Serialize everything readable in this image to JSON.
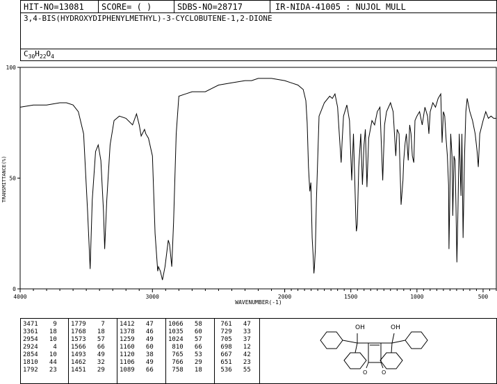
{
  "header": {
    "hit_no": "HIT-NO=13081",
    "score": "SCORE=  (   )",
    "sdbs_no": "SDBS-NO=28717",
    "ir_code": "IR-NIDA-41005 : NUJOL MULL"
  },
  "compound": {
    "name": "3,4-BIS(HYDROXYDIPHENYLMETHYL)-3-CYCLOBUTENE-1,2-DIONE",
    "formula_c": "C",
    "formula_c_sub": "30",
    "formula_h": "H",
    "formula_h_sub": "22",
    "formula_o": "O",
    "formula_o_sub": "4"
  },
  "chart_data": {
    "type": "line",
    "title": "",
    "xlabel": "WAVENUMBER(-1)",
    "ylabel": "TRANSMITTANCE(%)",
    "xlim": [
      4000,
      400
    ],
    "ylim": [
      0,
      100
    ],
    "x_ticks": [
      4000,
      3000,
      2000,
      1500,
      1000,
      500
    ],
    "y_ticks": [
      0,
      50,
      100
    ],
    "spectrum": [
      [
        4000,
        82
      ],
      [
        3900,
        83
      ],
      [
        3800,
        83
      ],
      [
        3700,
        84
      ],
      [
        3650,
        84
      ],
      [
        3600,
        83
      ],
      [
        3560,
        80
      ],
      [
        3520,
        70
      ],
      [
        3490,
        35
      ],
      [
        3471,
        9
      ],
      [
        3455,
        40
      ],
      [
        3430,
        62
      ],
      [
        3410,
        65
      ],
      [
        3390,
        58
      ],
      [
        3370,
        35
      ],
      [
        3361,
        18
      ],
      [
        3345,
        40
      ],
      [
        3320,
        65
      ],
      [
        3290,
        76
      ],
      [
        3250,
        78
      ],
      [
        3200,
        77
      ],
      [
        3150,
        74
      ],
      [
        3120,
        79
      ],
      [
        3100,
        74
      ],
      [
        3085,
        69
      ],
      [
        3060,
        72
      ],
      [
        3050,
        70
      ],
      [
        3030,
        68
      ],
      [
        3000,
        60
      ],
      [
        2980,
        25
      ],
      [
        2960,
        8
      ],
      [
        2954,
        10
      ],
      [
        2940,
        8
      ],
      [
        2924,
        4
      ],
      [
        2905,
        10
      ],
      [
        2880,
        22
      ],
      [
        2870,
        20
      ],
      [
        2854,
        10
      ],
      [
        2840,
        30
      ],
      [
        2820,
        70
      ],
      [
        2800,
        87
      ],
      [
        2750,
        88
      ],
      [
        2700,
        89
      ],
      [
        2600,
        89
      ],
      [
        2500,
        92
      ],
      [
        2400,
        93
      ],
      [
        2300,
        94
      ],
      [
        2250,
        94
      ],
      [
        2200,
        95
      ],
      [
        2100,
        95
      ],
      [
        2000,
        94
      ],
      [
        1950,
        93
      ],
      [
        1900,
        92
      ],
      [
        1860,
        90
      ],
      [
        1840,
        85
      ],
      [
        1830,
        75
      ],
      [
        1820,
        55
      ],
      [
        1810,
        44
      ],
      [
        1802,
        48
      ],
      [
        1792,
        23
      ],
      [
        1785,
        15
      ],
      [
        1779,
        7
      ],
      [
        1775,
        10
      ],
      [
        1768,
        18
      ],
      [
        1760,
        40
      ],
      [
        1740,
        78
      ],
      [
        1700,
        84
      ],
      [
        1660,
        87
      ],
      [
        1640,
        86
      ],
      [
        1620,
        88
      ],
      [
        1600,
        82
      ],
      [
        1585,
        68
      ],
      [
        1573,
        57
      ],
      [
        1566,
        66
      ],
      [
        1555,
        78
      ],
      [
        1530,
        83
      ],
      [
        1510,
        76
      ],
      [
        1493,
        49
      ],
      [
        1480,
        70
      ],
      [
        1462,
        32
      ],
      [
        1458,
        26
      ],
      [
        1451,
        29
      ],
      [
        1440,
        55
      ],
      [
        1425,
        70
      ],
      [
        1412,
        47
      ],
      [
        1400,
        65
      ],
      [
        1390,
        72
      ],
      [
        1378,
        46
      ],
      [
        1365,
        68
      ],
      [
        1340,
        76
      ],
      [
        1320,
        74
      ],
      [
        1300,
        80
      ],
      [
        1280,
        82
      ],
      [
        1259,
        49
      ],
      [
        1245,
        74
      ],
      [
        1230,
        80
      ],
      [
        1200,
        84
      ],
      [
        1180,
        80
      ],
      [
        1160,
        60
      ],
      [
        1150,
        72
      ],
      [
        1135,
        70
      ],
      [
        1120,
        38
      ],
      [
        1106,
        49
      ],
      [
        1100,
        58
      ],
      [
        1089,
        66
      ],
      [
        1080,
        70
      ],
      [
        1066,
        58
      ],
      [
        1055,
        74
      ],
      [
        1045,
        70
      ],
      [
        1035,
        60
      ],
      [
        1024,
        57
      ],
      [
        1015,
        76
      ],
      [
        1000,
        78
      ],
      [
        980,
        80
      ],
      [
        960,
        74
      ],
      [
        940,
        82
      ],
      [
        920,
        78
      ],
      [
        910,
        70
      ],
      [
        900,
        80
      ],
      [
        880,
        84
      ],
      [
        860,
        82
      ],
      [
        840,
        86
      ],
      [
        820,
        88
      ],
      [
        810,
        66
      ],
      [
        800,
        80
      ],
      [
        790,
        78
      ],
      [
        780,
        68
      ],
      [
        770,
        60
      ],
      [
        765,
        53
      ],
      [
        761,
        47
      ],
      [
        758,
        18
      ],
      [
        752,
        38
      ],
      [
        745,
        70
      ],
      [
        735,
        60
      ],
      [
        729,
        33
      ],
      [
        720,
        60
      ],
      [
        712,
        58
      ],
      [
        705,
        37
      ],
      [
        698,
        12
      ],
      [
        690,
        35
      ],
      [
        680,
        70
      ],
      [
        667,
        42
      ],
      [
        660,
        70
      ],
      [
        651,
        23
      ],
      [
        640,
        60
      ],
      [
        630,
        80
      ],
      [
        620,
        86
      ],
      [
        600,
        80
      ],
      [
        580,
        76
      ],
      [
        560,
        70
      ],
      [
        545,
        62
      ],
      [
        536,
        55
      ],
      [
        525,
        70
      ],
      [
        500,
        76
      ],
      [
        480,
        80
      ],
      [
        460,
        77
      ],
      [
        440,
        78
      ],
      [
        420,
        77
      ],
      [
        400,
        77
      ]
    ],
    "peak_table": [
      [
        [
          3471,
          9
        ],
        [
          3361,
          18
        ],
        [
          2954,
          10
        ],
        [
          2924,
          4
        ],
        [
          2854,
          10
        ],
        [
          1810,
          44
        ],
        [
          1792,
          23
        ]
      ],
      [
        [
          1779,
          7
        ],
        [
          1768,
          18
        ],
        [
          1573,
          57
        ],
        [
          1566,
          66
        ],
        [
          1493,
          49
        ],
        [
          1462,
          32
        ],
        [
          1451,
          29
        ]
      ],
      [
        [
          1412,
          47
        ],
        [
          1378,
          46
        ],
        [
          1259,
          49
        ],
        [
          1160,
          60
        ],
        [
          1120,
          38
        ],
        [
          1106,
          49
        ],
        [
          1089,
          66
        ]
      ],
      [
        [
          1066,
          58
        ],
        [
          1035,
          60
        ],
        [
          1024,
          57
        ],
        [
          810,
          66
        ],
        [
          765,
          53
        ],
        [
          766,
          29
        ],
        [
          758,
          18
        ]
      ],
      [
        [
          761,
          47
        ],
        [
          729,
          33
        ],
        [
          705,
          37
        ],
        [
          698,
          12
        ],
        [
          667,
          42
        ],
        [
          651,
          23
        ],
        [
          536,
          55
        ]
      ]
    ]
  },
  "structure": {
    "oh_left": "OH",
    "oh_right": "OH",
    "o_bottom_left": "O",
    "o_bottom_right": "O"
  }
}
